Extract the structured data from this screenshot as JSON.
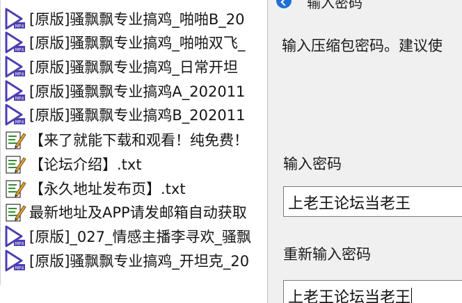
{
  "file_list": {
    "items": [
      {
        "icon": "mp4-video-icon",
        "name": "[原版]骚飘飘专业搞鸡_啪啪B_20"
      },
      {
        "icon": "mp4-video-icon",
        "name": "[原版]骚飘飘专业搞鸡_啪啪双飞_"
      },
      {
        "icon": "mp4-video-icon",
        "name": "[原版]骚飘飘专业搞鸡_日常开坦"
      },
      {
        "icon": "mp4-video-icon",
        "name": "[原版]骚飘飘专业搞鸡A_202011"
      },
      {
        "icon": "mp4-video-icon",
        "name": "[原版]骚飘飘专业搞鸡B_202011"
      },
      {
        "icon": "text-file-icon",
        "name": "【来了就能下载和观看！纯免费！"
      },
      {
        "icon": "text-file-icon",
        "name": "【论坛介绍】.txt"
      },
      {
        "icon": "text-file-icon",
        "name": "【永久地址发布页】.txt"
      },
      {
        "icon": "text-file-icon",
        "name": "最新地址及APP请发邮箱自动获取"
      },
      {
        "icon": "mp4-video-icon",
        "name": "[原版]_027_情感主播李寻欢_骚飘"
      },
      {
        "icon": "mp4-video-icon",
        "name": "[原版]骚飘飘专业搞鸡_开坦克_20"
      }
    ]
  },
  "dialog": {
    "title": "输入密码",
    "hint": "输入压缩包密码。建议使",
    "password_label": "输入密码",
    "password_value": "上老王论坛当老王",
    "confirm_label": "重新输入密码",
    "confirm_value": "上老王论坛当老王",
    "accent_color": "#1f6fd6"
  },
  "colors": {
    "video_icon": "#4b3fb0",
    "text_icon_green": "#2f8f2f"
  }
}
